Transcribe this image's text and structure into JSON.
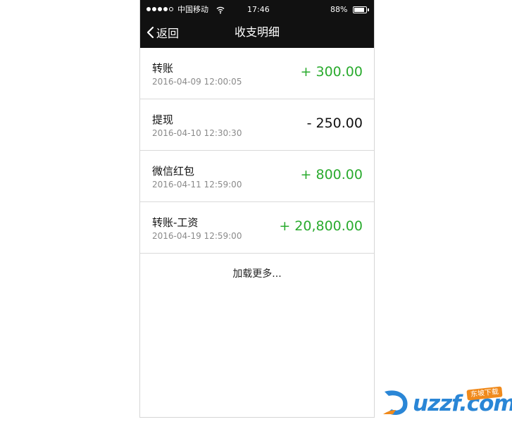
{
  "status_bar": {
    "carrier": "中国移动",
    "time": "17:46",
    "battery": "88%",
    "battery_level": 0.88
  },
  "nav": {
    "back_label": "返回",
    "title": "收支明细"
  },
  "transactions": [
    {
      "title": "转账",
      "time": "2016-04-09 12:00:05",
      "amount": "+ 300.00",
      "type": "income"
    },
    {
      "title": "提现",
      "time": "2016-04-10 12:30:30",
      "amount": "- 250.00",
      "type": "expense"
    },
    {
      "title": "微信红包",
      "time": "2016-04-11 12:59:00",
      "amount": "+ 800.00",
      "type": "income"
    },
    {
      "title": "转账-工资",
      "time": "2016-04-19 12:59:00",
      "amount": "+ 20,800.00",
      "type": "income"
    }
  ],
  "load_more_label": "加载更多...",
  "watermark": {
    "brand": "uzzf.com",
    "badge": "东坡下载"
  },
  "colors": {
    "income": "#2aab2e",
    "expense": "#111111",
    "header": "#111111"
  }
}
